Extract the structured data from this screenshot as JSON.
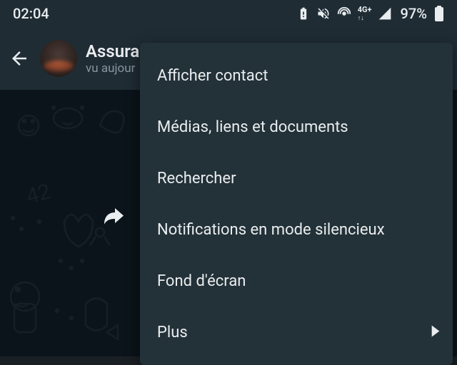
{
  "status": {
    "time": "02:04",
    "battery_pct": "97%"
  },
  "header": {
    "contact_name": "Assura",
    "last_seen": "vu aujour"
  },
  "menu": {
    "items": [
      {
        "label": "Afficher contact",
        "has_submenu": false
      },
      {
        "label": "Médias, liens et documents",
        "has_submenu": false
      },
      {
        "label": "Rechercher",
        "has_submenu": false
      },
      {
        "label": "Notifications en mode silencieux",
        "has_submenu": false
      },
      {
        "label": "Fond d'écran",
        "has_submenu": false
      },
      {
        "label": "Plus",
        "has_submenu": true
      }
    ]
  }
}
